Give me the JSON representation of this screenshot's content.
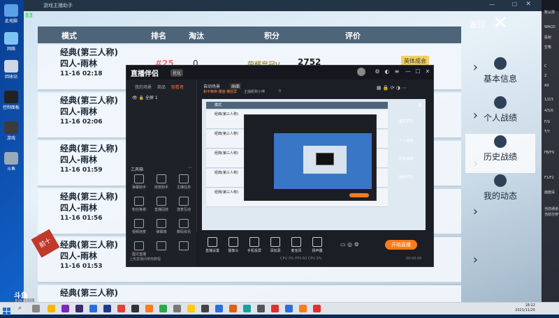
{
  "fps": "83",
  "game_title": "游戏主播助手",
  "table": {
    "headers": {
      "mode": "模式",
      "rank": "排名",
      "elim": "淘汰",
      "points": "积分",
      "rating": "评价"
    },
    "rows": [
      {
        "mode": "经典(第三人称)",
        "map": "四人-雨林",
        "time": "11-16 02:18"
      },
      {
        "mode": "经典(第三人称)",
        "map": "四人-雨林",
        "time": "11-16 02:06"
      },
      {
        "mode": "经典(第三人称)",
        "map": "四人-雨林",
        "time": "11-16 01:59"
      },
      {
        "mode": "经典(第三人称)",
        "map": "四人-雨林",
        "time": "11-16 01:56"
      },
      {
        "mode": "经典(第三人称)",
        "map": "四人-雨林",
        "time": "11-16 01:53"
      },
      {
        "mode": "经典(第三人称)",
        "map": "",
        "time": ""
      }
    ],
    "first_row": {
      "rank": "#25",
      "elim": "0",
      "tier": "荣耀皇冠V",
      "points": "2752",
      "badge": "英体成会"
    },
    "ribbon": "前十"
  },
  "right_nav": {
    "back": "返回",
    "items": [
      {
        "label": "基本信息",
        "active": false
      },
      {
        "label": "个人战绩",
        "active": false
      },
      {
        "label": "历史战绩",
        "active": true
      },
      {
        "label": "我的动态",
        "active": false
      }
    ]
  },
  "stream": {
    "logo": "直播伴侣",
    "badge": "优化",
    "tabs": [
      "我的场景",
      "商品",
      "观看者"
    ],
    "active_tab": 2,
    "scene_item": "全屏 1",
    "tools_title": "工具箱",
    "tools": [
      "弹幕助手",
      "房管助手",
      "主播任务",
      "粉丝答谢",
      "直播回放",
      "连麦互动",
      "视频连麦",
      "弹幕墙",
      "数码资讯",
      "图文直播",
      "",
      ""
    ],
    "left_footer": "上热直播间使用教程",
    "scene_tabs": [
      "自动场景",
      "画面"
    ],
    "sources": [
      "和平精英·攥盘·横竖屏",
      "主播昵称小呷",
      "0"
    ],
    "bottom_buttons": [
      "直播设置",
      "摄像头",
      "手机投屏",
      "添加源",
      "麦克风",
      "扬声器"
    ],
    "go_live": "开始直播",
    "stats": "CPU 0%   FPS 60   CPU 0%",
    "clock": "00:00:00",
    "preview_title": "模式",
    "preview_nav": [
      "基本信息",
      "个人战绩",
      "历史战绩",
      "我的动态"
    ]
  },
  "right_panel": {
    "lines": [
      "数认限",
      "WAGD",
      "投射",
      "空格",
      "C",
      "Z",
      "Alt",
      "1/2/3",
      "4/5/6",
      "F/G",
      "T/Y",
      "FB/F9",
      "F1/F2",
      "画面设",
      "当前通道",
      "当前分辨"
    ]
  },
  "watermark": {
    "logo": "斗鱼",
    "room": "8968831"
  },
  "desktop_icons": [
    "此电脑",
    "网络",
    "回收站",
    "控制面板",
    "游戏",
    "斗鱼"
  ],
  "taskbar": {
    "time": "18:22",
    "date": "2021/11/25"
  },
  "colors": {
    "accent": "#ff7a18",
    "fps_green": "#38e04a",
    "table_head": "#4d6479"
  }
}
